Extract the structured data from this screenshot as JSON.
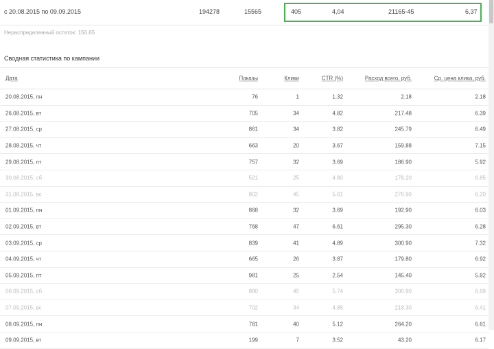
{
  "summary": {
    "period": "c 20.08.2015 по 09.09.2015",
    "shows": "194278",
    "clicks": "15565",
    "ctr_total": "405",
    "ctr": "4,04",
    "cost": "21165-45",
    "cpc": "6,37"
  },
  "note": "Нераспределенный остаток: 150,65",
  "section_title": "Сводная статистика по кампании",
  "table": {
    "headers": [
      "Дата",
      "Показы",
      "Клики",
      "CTR (%)",
      "Расход всего, руб.",
      "Ср. цена клика, руб."
    ],
    "rows": [
      {
        "date": "20.08.2015, пн",
        "shows": "76",
        "clicks": "1",
        "ctr": "1.32",
        "cost": "2.18",
        "cpc": "2.18",
        "weekend": false
      },
      {
        "date": "26.08.2015, вт",
        "shows": "705",
        "clicks": "34",
        "ctr": "4.82",
        "cost": "217.48",
        "cpc": "6.39",
        "weekend": false
      },
      {
        "date": "27.08.2015, ср",
        "shows": "861",
        "clicks": "34",
        "ctr": "3.82",
        "cost": "245.79",
        "cpc": "6.49",
        "weekend": false
      },
      {
        "date": "28.08.2015, чт",
        "shows": "663",
        "clicks": "20",
        "ctr": "3.67",
        "cost": "159.88",
        "cpc": "7.15",
        "weekend": false
      },
      {
        "date": "29.08.2015, пт",
        "shows": "757",
        "clicks": "32",
        "ctr": "3.69",
        "cost": "186.90",
        "cpc": "5.92",
        "weekend": false
      },
      {
        "date": "30.08.2015, сб",
        "shows": "521",
        "clicks": "25",
        "ctr": "4.80",
        "cost": "178.20",
        "cpc": "6.85",
        "weekend": true
      },
      {
        "date": "31.08.2015, вс",
        "shows": "802",
        "clicks": "45",
        "ctr": "5.61",
        "cost": "278.90",
        "cpc": "6.20",
        "weekend": true
      },
      {
        "date": "01.09.2015, пн",
        "shows": "868",
        "clicks": "32",
        "ctr": "3.69",
        "cost": "192.90",
        "cpc": "6.03",
        "weekend": false
      },
      {
        "date": "02.09.2015, вт",
        "shows": "768",
        "clicks": "47",
        "ctr": "6.61",
        "cost": "295.30",
        "cpc": "6.28",
        "weekend": false
      },
      {
        "date": "03.09.2015, ср",
        "shows": "839",
        "clicks": "41",
        "ctr": "4.89",
        "cost": "300.90",
        "cpc": "7.32",
        "weekend": false
      },
      {
        "date": "04.09.2015, чт",
        "shows": "665",
        "clicks": "26",
        "ctr": "3.87",
        "cost": "179.80",
        "cpc": "6.92",
        "weekend": false
      },
      {
        "date": "05.09.2015, пт",
        "shows": "981",
        "clicks": "25",
        "ctr": "2.54",
        "cost": "145.40",
        "cpc": "5.82",
        "weekend": false
      },
      {
        "date": "06.09.2015, сб",
        "shows": "880",
        "clicks": "45",
        "ctr": "5.74",
        "cost": "300.90",
        "cpc": "6.69",
        "weekend": true
      },
      {
        "date": "07.09.2015, вс",
        "shows": "702",
        "clicks": "34",
        "ctr": "4.85",
        "cost": "218.30",
        "cpc": "6.41",
        "weekend": true
      },
      {
        "date": "08.09.2015, пн",
        "shows": "781",
        "clicks": "40",
        "ctr": "5.12",
        "cost": "264.20",
        "cpc": "6.61",
        "weekend": false
      },
      {
        "date": "09.09.2015, вт",
        "shows": "199",
        "clicks": "7",
        "ctr": "3.52",
        "cost": "43.20",
        "cpc": "6.17",
        "weekend": false
      }
    ]
  }
}
